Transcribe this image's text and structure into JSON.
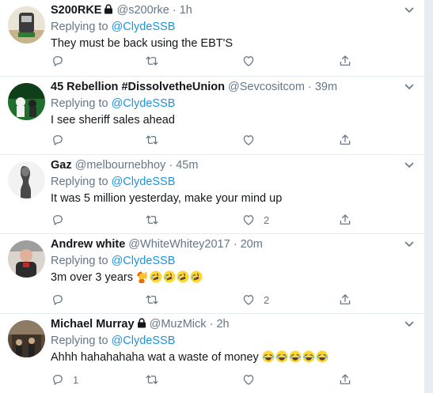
{
  "tweets": [
    {
      "name": "S200RKE",
      "protected": true,
      "handle": "@s200rke",
      "separator": "·",
      "time": "1h",
      "replying_prefix": "Replying to ",
      "replying_to": "@ClydeSSB",
      "text": "They must be back using the EBT'S",
      "emojis": [],
      "reply_count": "",
      "retweet_count": "",
      "like_count": ""
    },
    {
      "name": "45 Rebellion #DissolvetheUnion",
      "protected": false,
      "handle": "@Sevcositcom",
      "separator": "·",
      "time": "39m",
      "replying_prefix": "Replying to ",
      "replying_to": "@ClydeSSB",
      "text": "I see sheriff sales ahead",
      "emojis": [],
      "reply_count": "",
      "retweet_count": "",
      "like_count": ""
    },
    {
      "name": "Gaz",
      "protected": false,
      "handle": "@melbournebhoy",
      "separator": "·",
      "time": "45m",
      "replying_prefix": "Replying to ",
      "replying_to": "@ClydeSSB",
      "text": "It was 5 million yesterday, make your mind up",
      "emojis": [],
      "reply_count": "",
      "retweet_count": "",
      "like_count": "2"
    },
    {
      "name": "Andrew white",
      "protected": false,
      "handle": "@WhiteWhitey2017",
      "separator": "·",
      "time": "20m",
      "replying_prefix": "Replying to ",
      "replying_to": "@ClydeSSB",
      "text": "3m over 3 years ",
      "emojis": [
        "person-raising-hand",
        "rolling-on-floor-laughing",
        "rolling-on-floor-laughing",
        "rolling-on-floor-laughing",
        "rolling-on-floor-laughing"
      ],
      "reply_count": "",
      "retweet_count": "",
      "like_count": "2"
    },
    {
      "name": "Michael Murray",
      "protected": true,
      "handle": "@MuzMick",
      "separator": "·",
      "time": "2h",
      "replying_prefix": "Replying to ",
      "replying_to": "@ClydeSSB",
      "text": "Ahhh hahahahaha wat a waste of money ",
      "emojis": [
        "face-with-tears-of-joy",
        "face-with-tears-of-joy",
        "face-with-tears-of-joy",
        "face-with-tears-of-joy",
        "face-with-tears-of-joy"
      ],
      "reply_count": "1",
      "retweet_count": "",
      "like_count": ""
    }
  ],
  "icons": {
    "reply": "reply-icon",
    "retweet": "retweet-icon",
    "like": "heart-icon",
    "share": "share-icon",
    "more": "chevron-down-icon",
    "lock": "lock-icon"
  },
  "colors": {
    "link": "#1b95e0",
    "secondary_text": "#657786",
    "primary_text": "#14171a",
    "border": "#e6ecf0"
  }
}
